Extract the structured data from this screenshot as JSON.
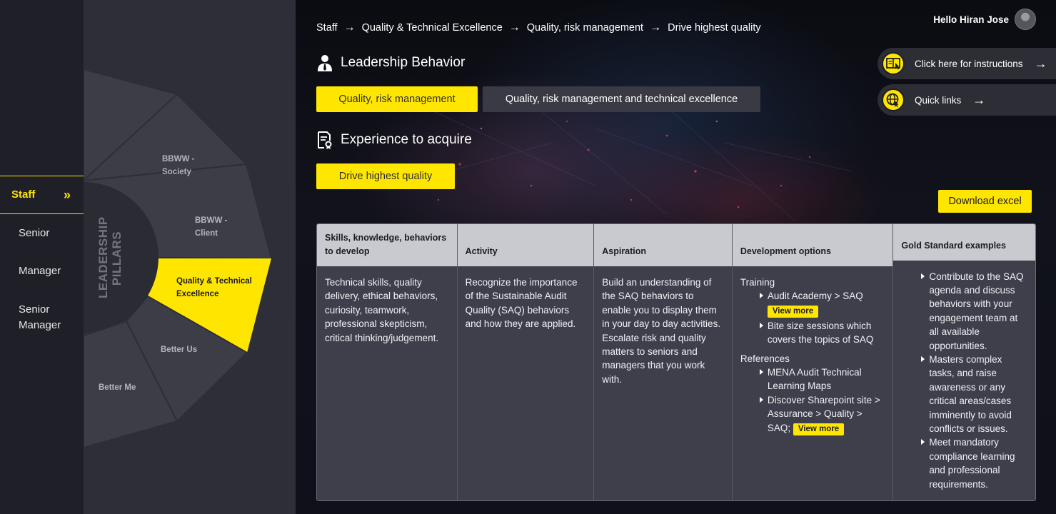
{
  "levels": [
    {
      "label": "Staff",
      "active": true
    },
    {
      "label": "Senior",
      "active": false
    },
    {
      "label": "Manager",
      "active": false
    },
    {
      "label": "Senior Manager",
      "active": false
    }
  ],
  "wheel": {
    "center_label_line1": "LEADERSHIP",
    "center_label_line2": "PILLARS",
    "segments": [
      {
        "label1": "BBWW -",
        "label2": "Society"
      },
      {
        "label1": "BBWW -",
        "label2": "Client"
      },
      {
        "label1": "Quality & Technical",
        "label2": "Excellence"
      },
      {
        "label1": "Better Us",
        "label2": ""
      },
      {
        "label1": "Better Me",
        "label2": ""
      }
    ]
  },
  "breadcrumb": [
    "Staff",
    "Quality & Technical Excellence",
    "Quality, risk management",
    "Drive highest quality"
  ],
  "user": {
    "greeting": "Hello Hiran Jose"
  },
  "leadership": {
    "title": "Leadership Behavior",
    "chips": [
      "Quality, risk management",
      "Quality, risk management and technical excellence"
    ]
  },
  "experience": {
    "title": "Experience to acquire",
    "chip": "Drive highest quality"
  },
  "side_links": {
    "instructions": "Click here for instructions",
    "quick_links": "Quick links"
  },
  "download_label": "Download excel",
  "table": {
    "headers": [
      "Skills, knowledge, behaviors to develop",
      "Activity",
      "Aspiration",
      "Development options",
      "Gold Standard examples"
    ],
    "skills": "Technical skills, quality delivery, ethical behaviors, curiosity, teamwork, professional skepticism, critical thinking/judgement.",
    "activity": "Recognize the importance of the Sustainable Audit Quality (SAQ) behaviors and how they are applied.",
    "aspiration": "Build an understanding of the SAQ behaviors to enable you to display them in your day to day activities. Escalate risk and quality matters to seniors and managers that you work with.",
    "development": {
      "training_label": "Training",
      "training_items": [
        "Audit Academy > SAQ",
        "Bite size sessions which covers the topics of SAQ"
      ],
      "references_label": "References",
      "reference_items": [
        "MENA Audit Technical Learning Maps",
        "Discover Sharepoint site > Assurance > Quality > SAQ;"
      ],
      "view_more": "View more"
    },
    "gold": [
      "Contribute to the SAQ agenda and discuss behaviors with your engagement team at all available opportunities.",
      "Masters complex tasks, and raise awareness or any critical areas/cases imminently to avoid conflicts or issues.",
      "Meet mandatory compliance learning and professional requirements."
    ]
  },
  "colors": {
    "accent": "#ffe600",
    "panel": "#2e2e38",
    "cell": "#3f3f4c",
    "header": "#c9c9d0"
  }
}
